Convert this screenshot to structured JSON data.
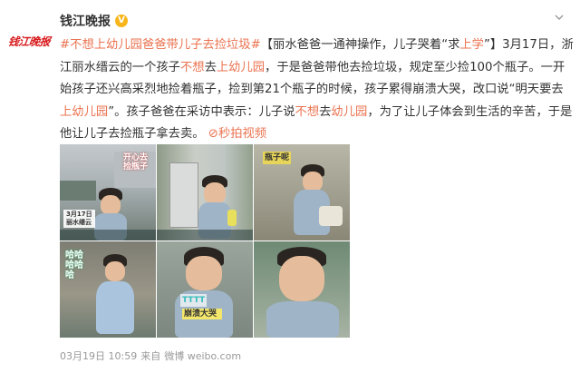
{
  "account": {
    "name": "钱江晚报",
    "avatar_text": "钱江晚报",
    "verified_icon": "verified-badge-icon",
    "menu_icon": "chevron-down-icon",
    "brand_color": "#d8191b",
    "verified_color": "#f7b51a"
  },
  "post": {
    "hashtag": "#不想上幼儿园爸爸带儿子去捡垃圾#",
    "seg1": "【丽水爸爸一通神操作，儿子哭着“求",
    "seg1_hl": "上学",
    "seg2": "”】3月17日，浙江丽水缙云的一个孩子",
    "seg2_hl1": "不想",
    "seg2_mid": "去",
    "seg2_hl2": "上幼儿园",
    "seg3": "，于是爸爸带他去捡垃圾，规定至少捡100个瓶子。一开始孩子还兴高采烈地捡着瓶子，捡到第21个瓶子的时候，孩子累得崩溃大哭，改口说“明天要去",
    "seg3_hl": "上幼儿园",
    "seg4": "”。孩子爸爸在采访中表示：儿子说",
    "seg4_hl1": "不想",
    "seg4_mid": "去",
    "seg4_hl2": "幼儿园",
    "seg5": "，为了让儿子体会到生活的辛苦，于是他让儿子去捡瓶子拿去卖。",
    "link_icon": "link-icon",
    "link_label": "秒拍视频",
    "link_color": "#eb7350"
  },
  "images": {
    "img1_caption_line1": "3月17日",
    "img1_caption_line2": "丽水缙云",
    "img6_sticker": "",
    "img4_sticker": "哈哈哈哈哈",
    "img3_sticker": "瓶子呢",
    "img5_sticker1": "TTTT",
    "img5_sticker2": "崩溃大哭",
    "img1_sticker": "开心去捡瓶子"
  },
  "footer": {
    "date": "03月19日 10:59",
    "from_label": "来自",
    "source": "微博 weibo.com"
  }
}
